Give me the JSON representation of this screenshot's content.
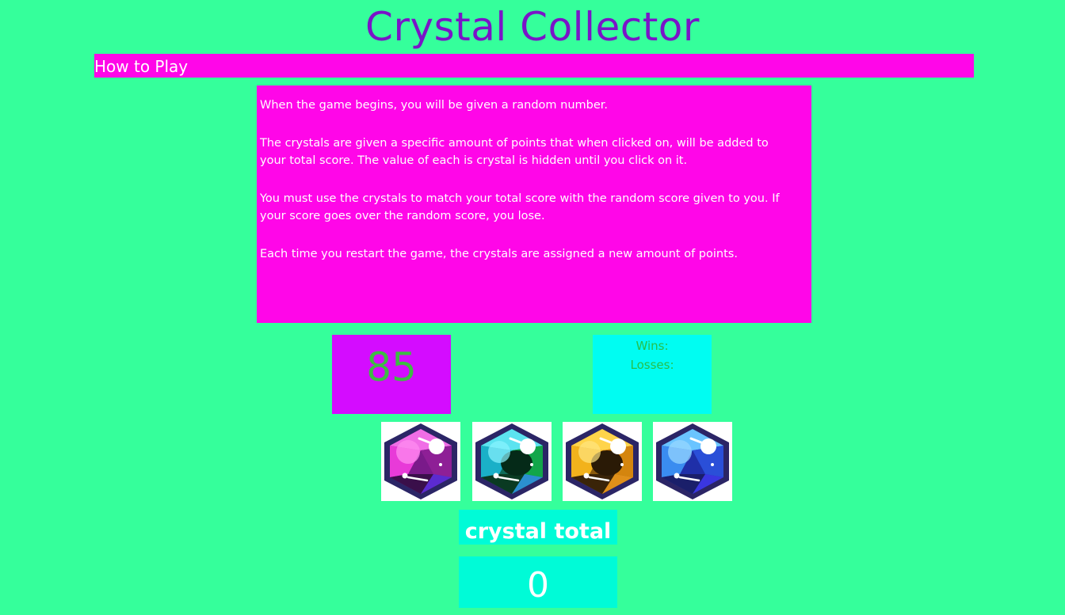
{
  "title": "Crystal Collector",
  "how_to_play": {
    "label": "How to Play",
    "paragraphs": [
      "When the game begins, you will be given a random number.",
      "The crystals are given a specific amount of points that when clicked on, will be added to your total score. The value of each is crystal is hidden until you click on it.",
      "You must use the crystals to match your total score with the random score given to you. If your score goes over the random score, you lose.",
      "Each time you restart the game, the crystals are assigned a new amount of points."
    ]
  },
  "target_number": "85",
  "scoreboard": {
    "wins_label": "Wins:",
    "losses_label": "Losses:"
  },
  "crystals": [
    {
      "name": "pink-crystal",
      "color": "#e83ad8"
    },
    {
      "name": "green-crystal",
      "color": "#2ec7d8"
    },
    {
      "name": "yellow-crystal",
      "color": "#f2b21c"
    },
    {
      "name": "blue-crystal",
      "color": "#3a78f0"
    }
  ],
  "crystal_total": {
    "label": "crystal total",
    "value": "0"
  },
  "colors": {
    "background": "#35ff9b",
    "title": "#7a14c8",
    "magenta_panel": "#ff06e8",
    "target_panel": "#d40cff",
    "score_panel": "#00fdf2",
    "total_panel": "#00fbd7"
  }
}
